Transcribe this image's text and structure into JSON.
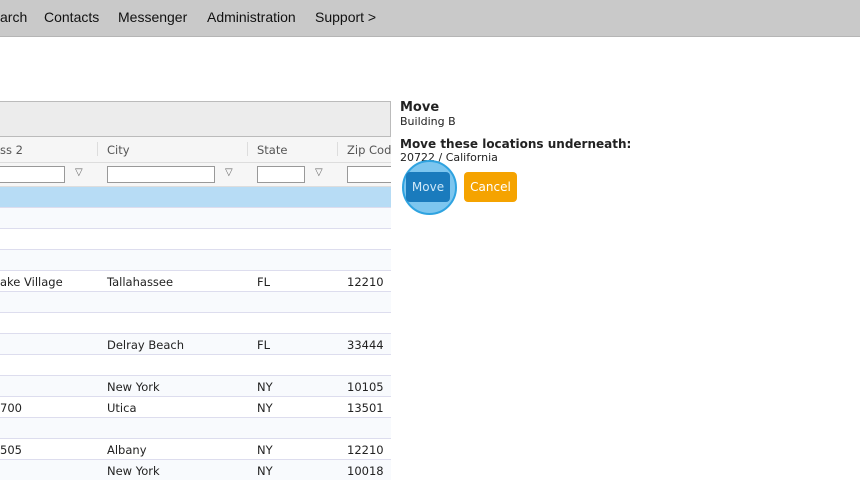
{
  "nav": {
    "items": [
      "arch",
      "Contacts",
      "Messenger",
      "Administration",
      "Support >"
    ]
  },
  "grid": {
    "columns": [
      "ss 2",
      "City",
      "State",
      "Zip Code"
    ],
    "rows": [
      {
        "addr2": "",
        "city": "",
        "state": "",
        "zip": "",
        "selected": true
      },
      {
        "addr2": "",
        "city": "",
        "state": "",
        "zip": ""
      },
      {
        "addr2": "",
        "city": "",
        "state": "",
        "zip": ""
      },
      {
        "addr2": "",
        "city": "",
        "state": "",
        "zip": ""
      },
      {
        "addr2": "ake Village",
        "city": "Tallahassee",
        "state": "FL",
        "zip": "12210"
      },
      {
        "addr2": "",
        "city": "",
        "state": "",
        "zip": ""
      },
      {
        "addr2": "",
        "city": "",
        "state": "",
        "zip": ""
      },
      {
        "addr2": "",
        "city": "Delray Beach",
        "state": "FL",
        "zip": "33444"
      },
      {
        "addr2": "",
        "city": "",
        "state": "",
        "zip": ""
      },
      {
        "addr2": "",
        "city": "New York",
        "state": "NY",
        "zip": "10105"
      },
      {
        "addr2": "700",
        "city": "Utica",
        "state": "NY",
        "zip": "13501"
      },
      {
        "addr2": "",
        "city": "",
        "state": "",
        "zip": ""
      },
      {
        "addr2": "505",
        "city": "Albany",
        "state": "NY",
        "zip": "12210"
      },
      {
        "addr2": "",
        "city": "New York",
        "state": "NY",
        "zip": "10018"
      }
    ]
  },
  "panel": {
    "title": "Move",
    "subtitle": "Building B",
    "prompt": "Move these locations underneath:",
    "target": "20722 / California",
    "move_label": "Move",
    "cancel_label": "Cancel"
  },
  "colors": {
    "move": "#1a7bbd",
    "cancel": "#f5a300",
    "selected_row": "#b7dcf5"
  }
}
